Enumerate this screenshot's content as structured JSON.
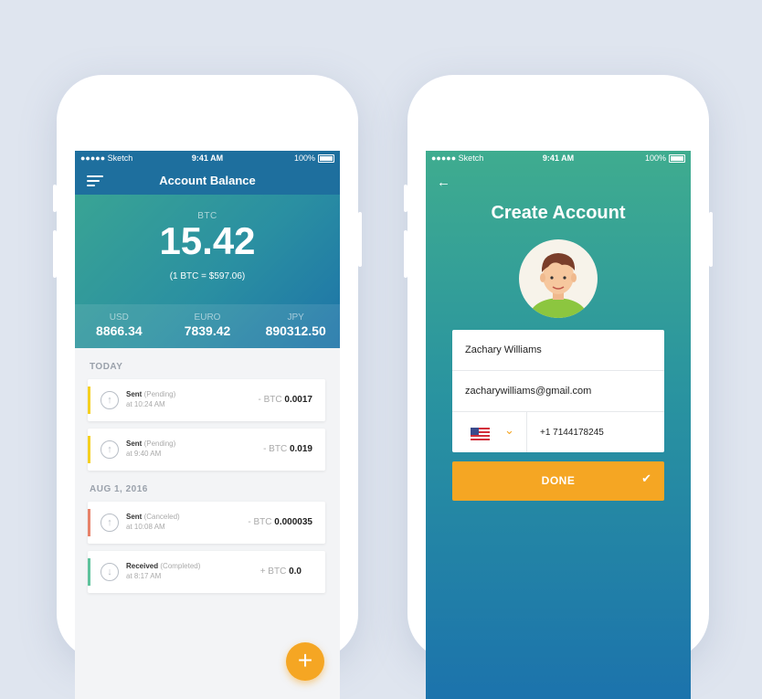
{
  "left": {
    "status": {
      "carrier": "●●●●● Sketch",
      "time": "9:41 AM",
      "battery": "100%"
    },
    "header": {
      "title": "Account Balance"
    },
    "balance": {
      "label": "BTC",
      "value": "15.42",
      "rate": "(1 BTC = $597.06)"
    },
    "currencies": [
      {
        "label": "USD",
        "value": "8866.34"
      },
      {
        "label": "EURO",
        "value": "7839.42"
      },
      {
        "label": "JPY",
        "value": "890312.50"
      }
    ],
    "sections": [
      "TODAY",
      "AUG 1, 2016"
    ],
    "transactions": [
      {
        "type": "Sent",
        "status": "(Pending)",
        "time": "at 10:24 AM",
        "prefix": "- BTC",
        "amount": "0.0017",
        "color": "#f5d020",
        "icon": "arrow-up-icon"
      },
      {
        "type": "Sent",
        "status": "(Pending)",
        "time": "at 9:40 AM",
        "prefix": "- BTC",
        "amount": "0.019",
        "color": "#f5d020",
        "icon": "arrow-up-icon"
      },
      {
        "type": "Sent",
        "status": "(Canceled)",
        "time": "at 10:08 AM",
        "prefix": "- BTC",
        "amount": "0.000035",
        "color": "#e7826a",
        "icon": "arrow-up-icon"
      },
      {
        "type": "Received",
        "status": "(Completed)",
        "time": "at 8:17 AM",
        "prefix": "+ BTC",
        "amount": "0.0",
        "color": "#5ec29c",
        "icon": "arrow-down-icon"
      }
    ],
    "fab": {
      "icon": "plus-icon",
      "label": "+"
    }
  },
  "right": {
    "status": {
      "carrier": "●●●●● Sketch",
      "time": "9:41 AM",
      "battery": "100%"
    },
    "title": "Create Account",
    "form": {
      "name": "Zachary Williams",
      "email": "zacharywilliams@gmail.com",
      "country_flag": "us-flag-icon",
      "phone": "+1 7144178245"
    },
    "done_label": "DONE"
  },
  "colors": {
    "accent": "#f5a623",
    "header": "#1e6f9e",
    "background": "#dfe5ef"
  }
}
